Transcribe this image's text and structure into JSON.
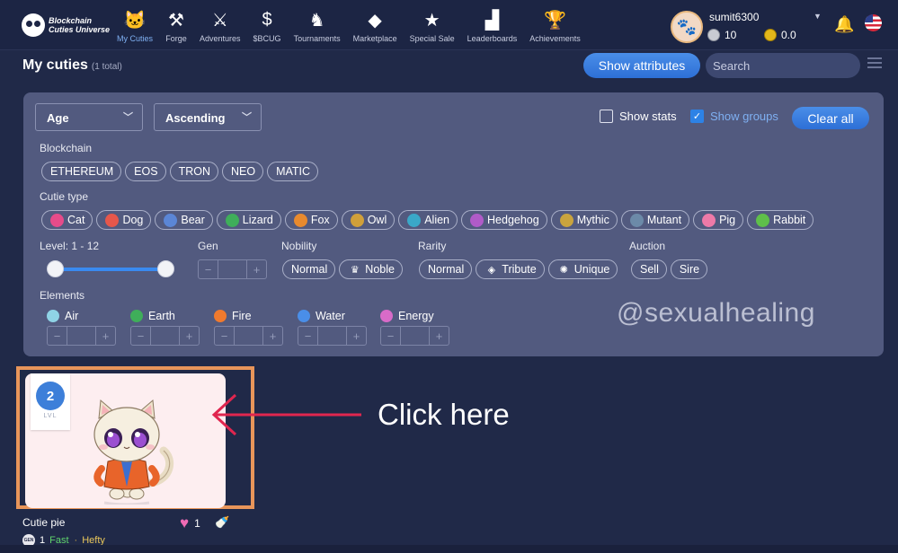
{
  "nav": {
    "logo_line1": "Blockchain",
    "logo_line2": "Cuties Universe",
    "items": [
      {
        "label": "My Cuties",
        "icon": "cat-face-icon",
        "glyph": "🐱",
        "active": true
      },
      {
        "label": "Forge",
        "icon": "anvil-icon",
        "glyph": "⚒",
        "active": false
      },
      {
        "label": "Adventures",
        "icon": "crossed-swords-icon",
        "glyph": "⚔",
        "active": false
      },
      {
        "label": "$BCUG",
        "icon": "bcug-token-icon",
        "glyph": "$",
        "active": false
      },
      {
        "label": "Tournaments",
        "icon": "helmet-icon",
        "glyph": "♞",
        "active": false
      },
      {
        "label": "Marketplace",
        "icon": "tag-icon",
        "glyph": "◆",
        "active": false
      },
      {
        "label": "Special Sale",
        "icon": "star-icon",
        "glyph": "★",
        "active": false
      },
      {
        "label": "Leaderboards",
        "icon": "podium-icon",
        "glyph": "▟",
        "active": false
      },
      {
        "label": "Achievements",
        "icon": "trophy-icon",
        "glyph": "🏆",
        "active": false
      }
    ]
  },
  "user": {
    "name": "sumit6300",
    "silver_balance": "10",
    "gold_balance": "0.0"
  },
  "header": {
    "title": "My cuties",
    "count": "(1 total)",
    "show_attributes": "Show attributes",
    "search_placeholder": "Search"
  },
  "filters": {
    "sort_field": "Age",
    "sort_order": "Ascending",
    "show_stats": "Show stats",
    "show_groups": "Show groups",
    "show_stats_checked": false,
    "show_groups_checked": true,
    "clear_all": "Clear all",
    "blockchain_label": "Blockchain",
    "blockchains": [
      "ETHEREUM",
      "EOS",
      "TRON",
      "NEO",
      "MATIC"
    ],
    "cutie_type_label": "Cutie type",
    "cutie_types": [
      {
        "label": "Cat",
        "icon": "cat-icon",
        "color": "#e64b8a"
      },
      {
        "label": "Dog",
        "icon": "dog-icon",
        "color": "#e6574b"
      },
      {
        "label": "Bear",
        "icon": "bear-icon",
        "color": "#5b86d6"
      },
      {
        "label": "Lizard",
        "icon": "lizard-icon",
        "color": "#3fae5a"
      },
      {
        "label": "Fox",
        "icon": "fox-icon",
        "color": "#e88a2e"
      },
      {
        "label": "Owl",
        "icon": "owl-icon",
        "color": "#d0a03a"
      },
      {
        "label": "Alien",
        "icon": "alien-icon",
        "color": "#3aa8c8"
      },
      {
        "label": "Hedgehog",
        "icon": "hedgehog-icon",
        "color": "#b05bc8"
      },
      {
        "label": "Mythic",
        "icon": "mythic-icon",
        "color": "#c9a43e"
      },
      {
        "label": "Mutant",
        "icon": "mutant-icon",
        "color": "#6c8aa8"
      },
      {
        "label": "Pig",
        "icon": "pig-icon",
        "color": "#ee7aa8"
      },
      {
        "label": "Rabbit",
        "icon": "rabbit-icon",
        "color": "#5fbf4a"
      }
    ],
    "level_label": "Level: 1 - 12",
    "level_min": 1,
    "level_max": 12,
    "gen_label": "Gen",
    "nobility_label": "Nobility",
    "nobility": [
      {
        "label": "Normal",
        "icon": ""
      },
      {
        "label": "Noble",
        "icon": "crown-icon"
      }
    ],
    "rarity_label": "Rarity",
    "rarity": [
      {
        "label": "Normal",
        "icon": ""
      },
      {
        "label": "Tribute",
        "icon": "gem-icon"
      },
      {
        "label": "Unique",
        "icon": "unique-icon"
      }
    ],
    "auction_label": "Auction",
    "auction": [
      "Sell",
      "Sire"
    ],
    "elements_label": "Elements",
    "elements": [
      {
        "label": "Air",
        "icon": "air-icon",
        "color": "#8fd3e6"
      },
      {
        "label": "Earth",
        "icon": "earth-leaf-icon",
        "color": "#3fae5a"
      },
      {
        "label": "Fire",
        "icon": "fire-icon",
        "color": "#f07a2e"
      },
      {
        "label": "Water",
        "icon": "water-drop-icon",
        "color": "#4a8ee8"
      },
      {
        "label": "Energy",
        "icon": "energy-icon",
        "color": "#d86bc8"
      }
    ]
  },
  "watermark": "@sexualhealing",
  "cutie": {
    "level": "2",
    "level_caption": "LVL",
    "name": "Cutie pie",
    "likes": "1",
    "gen_badge": "GEN",
    "generation": "1",
    "speed": "Fast",
    "build": "Hefty"
  },
  "annotation": "Click here",
  "colors": {
    "background": "#202948",
    "panel": "#525a7f",
    "accent": "#2d6fd6",
    "highlight_frame": "#e8955a",
    "arrow": "#e0264f"
  }
}
